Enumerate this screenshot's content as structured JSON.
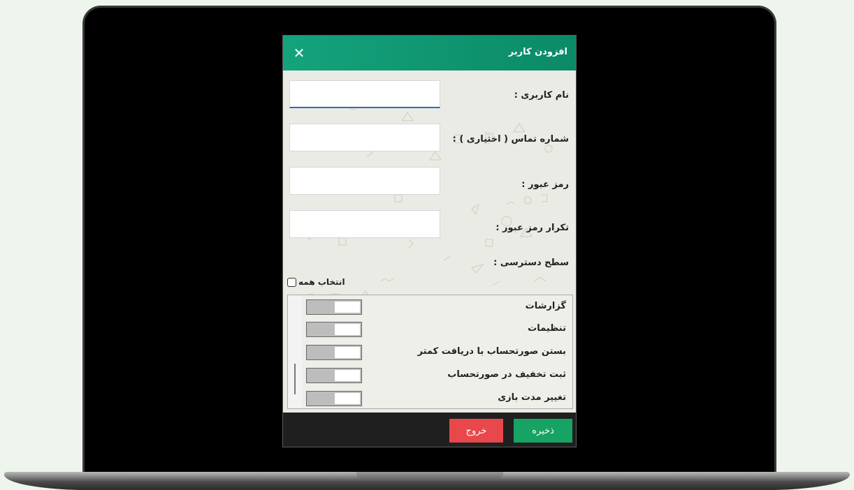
{
  "dialog": {
    "title": "افزودن کاربر",
    "close_icon": "close-icon"
  },
  "form": {
    "username_label": "نام کاربری :",
    "username_value": "",
    "phone_label": "شماره تماس ( اختیاری ) :",
    "phone_value": "",
    "password_label": "رمز عبور :",
    "password_value": "",
    "confirm_label": "تکرار رمز عبور :",
    "confirm_value": "",
    "access_label": "سطح دسترسی :"
  },
  "select_all_label": "انتخاب همه",
  "permissions": [
    {
      "label": "گزارشات",
      "enabled": false
    },
    {
      "label": "تنظیمات",
      "enabled": false
    },
    {
      "label": "بستن صورتحساب با دریافت کمتر",
      "enabled": false
    },
    {
      "label": "ثبت تخفیف در صورتحساب",
      "enabled": false
    },
    {
      "label": "تغییر مدت بازی",
      "enabled": false
    }
  ],
  "buttons": {
    "save_label": "ذخیره",
    "exit_label": "خروج"
  },
  "colors": {
    "header": "#0b8a67",
    "save": "#17a364",
    "exit": "#e8474b"
  }
}
